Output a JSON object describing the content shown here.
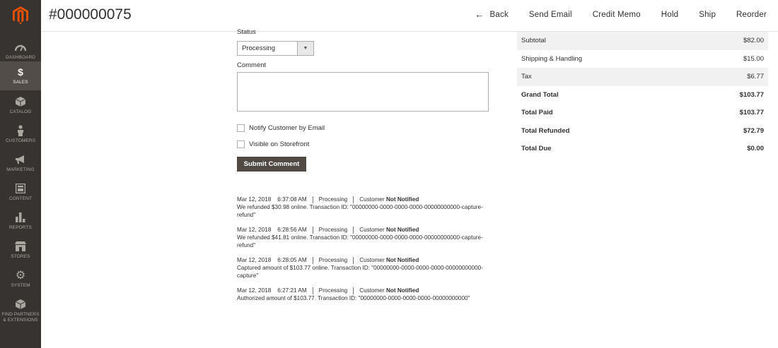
{
  "header": {
    "order_number": "#000000075",
    "actions": [
      "Back",
      "Send Email",
      "Credit Memo",
      "Hold",
      "Ship",
      "Reorder"
    ]
  },
  "sidebar": {
    "items": [
      {
        "label": "DASHBOARD",
        "icon": "dashboard-icon"
      },
      {
        "label": "SALES",
        "icon": "dollar-icon"
      },
      {
        "label": "CATALOG",
        "icon": "box-icon"
      },
      {
        "label": "CUSTOMERS",
        "icon": "person-icon"
      },
      {
        "label": "MARKETING",
        "icon": "megaphone-icon"
      },
      {
        "label": "CONTENT",
        "icon": "layout-icon"
      },
      {
        "label": "REPORTS",
        "icon": "bar-chart-icon"
      },
      {
        "label": "STORES",
        "icon": "store-icon"
      },
      {
        "label": "SYSTEM",
        "icon": "gear-icon"
      },
      {
        "label_line1": "FIND PARTNERS",
        "label_line2": "& EXTENSIONS",
        "icon": "cube-icon"
      }
    ],
    "active": "SALES"
  },
  "form": {
    "status_label": "Status",
    "status_value": "Processing",
    "comment_label": "Comment",
    "comment_value": "",
    "notify_label": "Notify Customer by Email",
    "visible_label": "Visible on Storefront",
    "submit_label": "Submit Comment"
  },
  "history": [
    {
      "date": "Mar 12, 2018",
      "time": "6:37:08 AM",
      "status": "Processing",
      "customer_prefix": "Customer",
      "customer_state": "Not Notified",
      "line1": "We refunded $30.98 online. Transaction ID: \"00000000-0000-0000-0000-00000000000-capture-",
      "line2": "refund\""
    },
    {
      "date": "Mar 12, 2018",
      "time": "6:28:56 AM",
      "status": "Processing",
      "customer_prefix": "Customer",
      "customer_state": "Not Notified",
      "line1": "We refunded $41.81 online. Transaction ID: \"00000000-0000-0000-0000-00000000000-capture-",
      "line2": "refund\""
    },
    {
      "date": "Mar 12, 2018",
      "time": "6:28:05 AM",
      "status": "Processing",
      "customer_prefix": "Customer",
      "customer_state": "Not Notified",
      "line1": "Captured amount of $103.77 online. Transaction ID: \"00000000-0000-0000-0000-00000000000-",
      "line2": "capture\""
    },
    {
      "date": "Mar 12, 2018",
      "time": "6:27:21 AM",
      "status": "Processing",
      "customer_prefix": "Customer",
      "customer_state": "Not Notified",
      "line1": "Authorized amount of $103.77. Transaction ID: \"00000000-0000-0000-0000-00000000000\"",
      "line2": ""
    }
  ],
  "totals": [
    {
      "label": "Subtotal",
      "value": "$82.00"
    },
    {
      "label": "Shipping & Handling",
      "value": "$15.00"
    },
    {
      "label": "Tax",
      "value": "$6.77"
    },
    {
      "label": "Grand Total",
      "value": "$103.77"
    },
    {
      "label": "Total Paid",
      "value": "$103.77"
    },
    {
      "label": "Total Refunded",
      "value": "$72.79"
    },
    {
      "label": "Total Due",
      "value": "$0.00"
    }
  ],
  "colors": {
    "sidebar_bg": "#373330",
    "sidebar_active": "#524d49",
    "logo_orange": "#eb5202",
    "button_bg": "#514943"
  }
}
